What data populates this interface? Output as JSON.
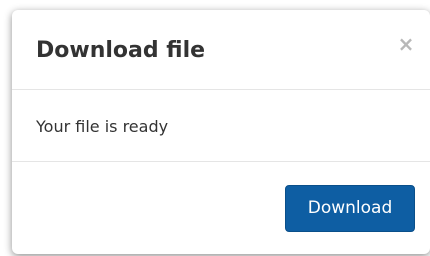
{
  "dialog": {
    "title": "Download file",
    "close_glyph": "×",
    "body_text": "Your file is ready",
    "primary_button_label": "Download"
  },
  "colors": {
    "primary_button": "#0e5ea3",
    "title_text": "#333333",
    "close_icon": "#b8b8b8"
  },
  "icons": {
    "close": "close-icon"
  }
}
